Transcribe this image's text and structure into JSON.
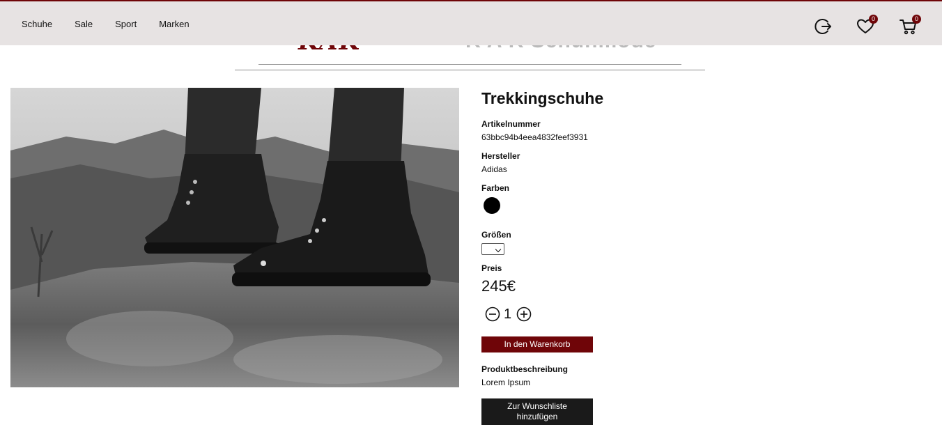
{
  "nav": {
    "links": [
      "Schuhe",
      "Sale",
      "Sport",
      "Marken"
    ],
    "logout_icon": "logout-icon",
    "wishlist_count": "0",
    "cart_count": "0"
  },
  "brand": {
    "logo_text": "KAK",
    "name": "K A K Schuhmode"
  },
  "product": {
    "title": "Trekkingschuhe",
    "article_label": "Artikelnummer",
    "article_number": "63bbc94b4eea4832feef3931",
    "maker_label": "Hersteller",
    "maker": "Adidas",
    "colors_label": "Farben",
    "colors": [
      "#000000"
    ],
    "sizes_label": "Größen",
    "price_label": "Preis",
    "price": "245€",
    "quantity": "1",
    "add_to_cart": "In den Warenkorb",
    "description_label": "Produktbeschreibung",
    "description": "Lorem Ipsum",
    "add_to_wishlist_line1": "Zur Wunschliste",
    "add_to_wishlist_line2": "hinzufügen"
  },
  "colors": {
    "accent": "#6f0508",
    "navbar_bg": "#e7e3e3",
    "dark_button": "#1a1a1a"
  }
}
